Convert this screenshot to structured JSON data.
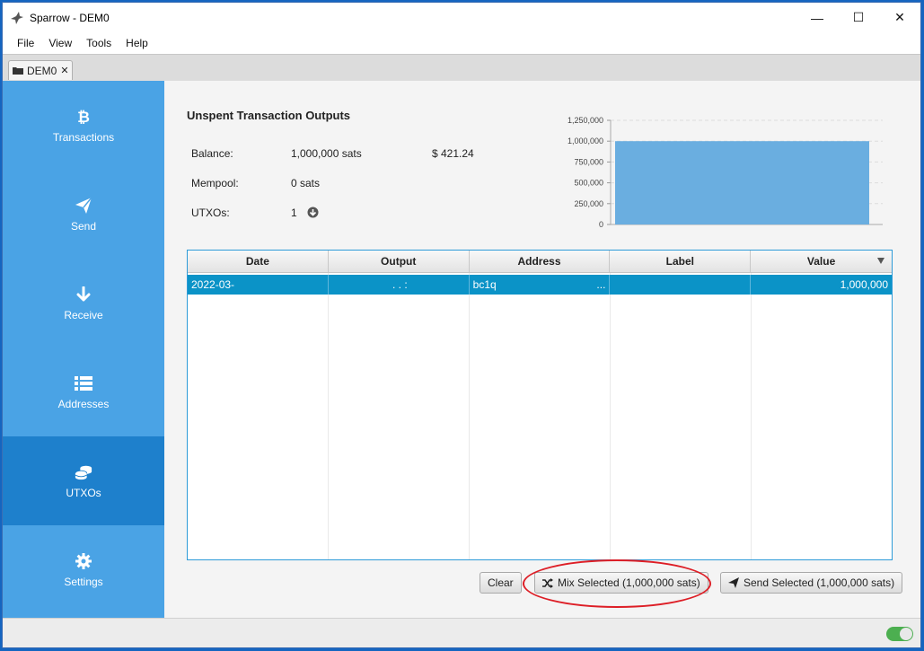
{
  "window": {
    "title": "Sparrow - DEM0",
    "minimize_glyph": "—",
    "maximize_glyph": "☐",
    "close_glyph": "✕"
  },
  "menu": [
    "File",
    "View",
    "Tools",
    "Help"
  ],
  "tab": {
    "label": "DEM0",
    "close_glyph": "✕"
  },
  "sidebar": {
    "items": [
      {
        "label": "Transactions",
        "icon": "bitcoin-icon"
      },
      {
        "label": "Send",
        "icon": "paper-plane-icon"
      },
      {
        "label": "Receive",
        "icon": "arrow-down-icon"
      },
      {
        "label": "Addresses",
        "icon": "list-icon"
      },
      {
        "label": "UTXOs",
        "icon": "coins-icon",
        "active": true
      },
      {
        "label": "Settings",
        "icon": "gear-icon"
      }
    ]
  },
  "utxos": {
    "heading": "Unspent Transaction Outputs",
    "balance_label": "Balance:",
    "balance_value": "1,000,000 sats",
    "balance_fiat": "$ 421.24",
    "mempool_label": "Mempool:",
    "mempool_value": "0 sats",
    "utxos_label": "UTXOs:",
    "utxos_value": "1"
  },
  "chart_data": {
    "type": "bar",
    "categories": [
      ""
    ],
    "values": [
      1000000
    ],
    "ylim": [
      0,
      1250000
    ],
    "yticks": [
      "0",
      "250,000",
      "500,000",
      "750,000",
      "1,000,000",
      "1,250,000"
    ],
    "grid": true,
    "color": "#6aaee0"
  },
  "table": {
    "columns": [
      "Date",
      "Output",
      "Address",
      "Label",
      "Value"
    ],
    "rows": [
      {
        "date": "2022-03-",
        "output": ". . :",
        "address": "bc1q",
        "address_tail": "...",
        "label": "",
        "value": "1,000,000"
      }
    ]
  },
  "buttons": {
    "clear": "Clear",
    "mix": "Mix Selected (1,000,000 sats)",
    "send": "Send Selected (1,000,000 sats)"
  },
  "colors": {
    "sidebar": "#4aa3e5",
    "sidebar_active": "#1e80cc",
    "selection": "#0b93c7",
    "annotation": "#dd1e26",
    "toggle": "#4caf50"
  }
}
